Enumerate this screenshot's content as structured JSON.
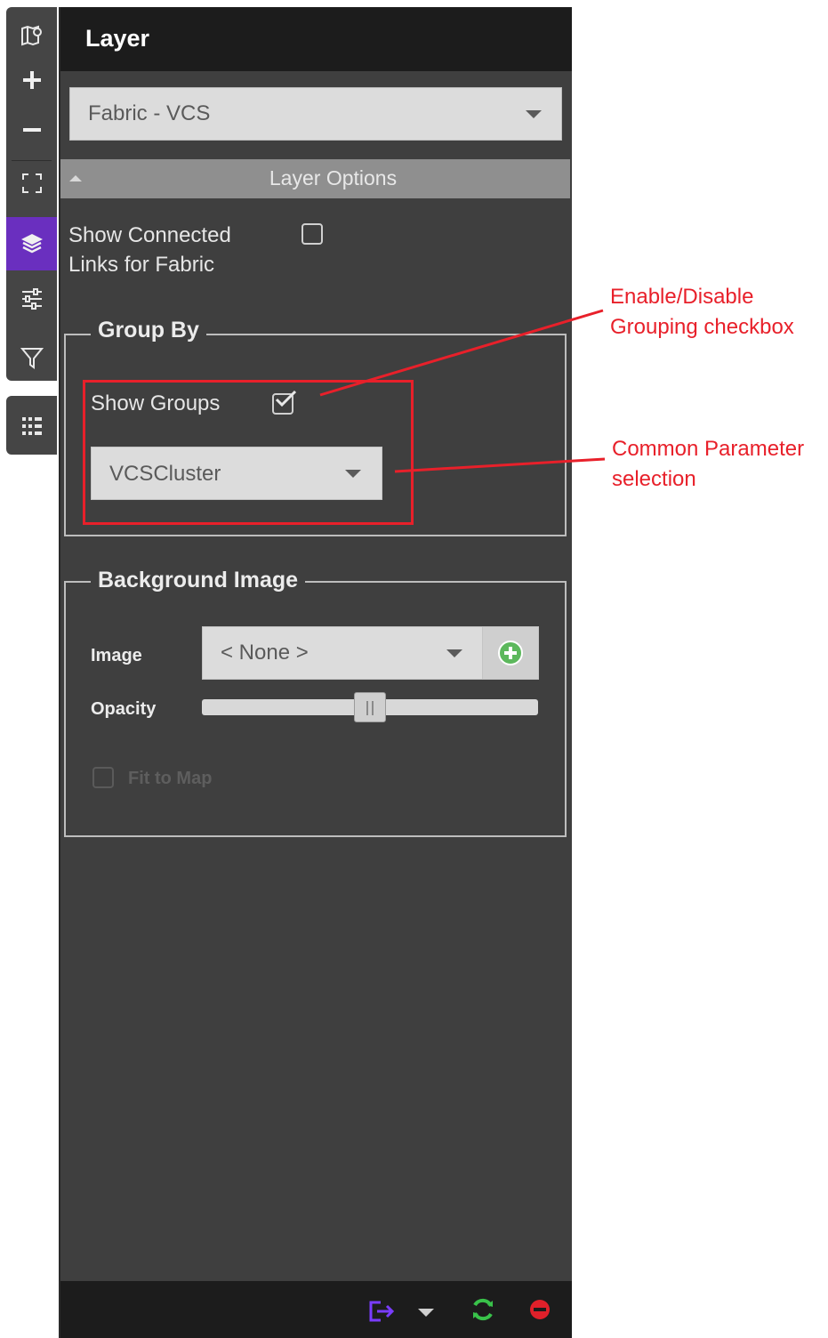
{
  "toolbar": {
    "buttons": [
      {
        "icon": "map-icon"
      },
      {
        "icon": "zoom-in-icon"
      },
      {
        "icon": "zoom-out-icon"
      },
      {
        "icon": "fit-screen-icon"
      },
      {
        "icon": "layers-icon",
        "active": true
      },
      {
        "icon": "sliders-icon"
      },
      {
        "icon": "filter-icon"
      },
      {
        "icon": "list-icon"
      }
    ],
    "active_color": "#6a2fbf"
  },
  "panel": {
    "title": "Layer",
    "layer_select": {
      "value": "Fabric - VCS"
    },
    "layer_options_label": "Layer Options",
    "show_connected_links": {
      "line1": "Show Connected",
      "line2": "Links for Fabric",
      "checked": false
    },
    "group_by": {
      "legend": "Group By",
      "show_groups_label": "Show Groups",
      "show_groups_checked": true,
      "parameter_select": {
        "value": "VCSCluster"
      }
    },
    "background_image": {
      "legend": "Background Image",
      "image_label": "Image",
      "image_select": {
        "value": "< None >"
      },
      "opacity_label": "Opacity",
      "opacity_value": 0.5,
      "fit_to_map_label": "Fit to Map",
      "fit_to_map_checked": false
    },
    "footer": {
      "icons": [
        "export-icon",
        "chevron-down-icon",
        "refresh-icon",
        "stop-icon"
      ]
    }
  },
  "annotations": {
    "grouping": {
      "line1": "Enable/Disable",
      "line2": "Grouping checkbox"
    },
    "parameter": {
      "line1": "Common Parameter",
      "line2": "selection"
    },
    "color": "#e8202a"
  }
}
